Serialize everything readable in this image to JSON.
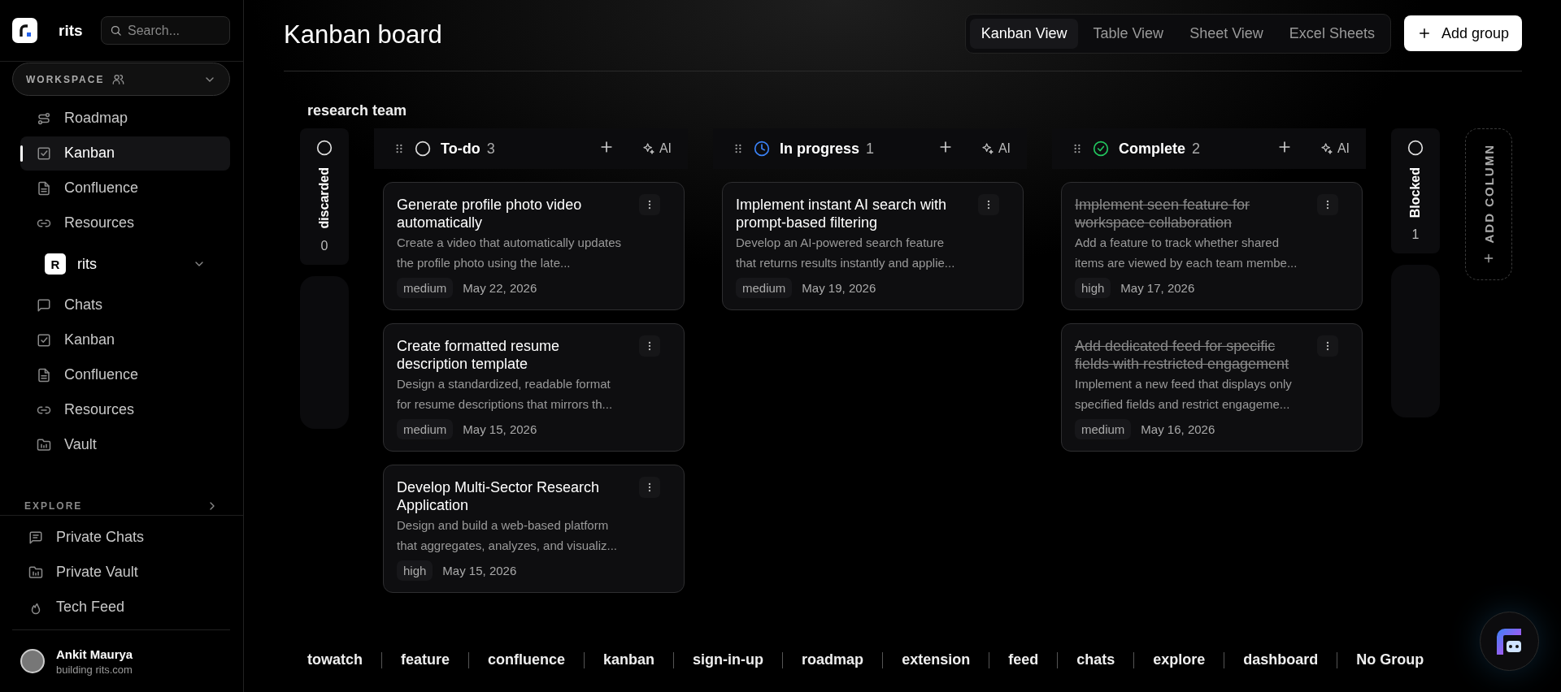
{
  "sidebar": {
    "brand": "rits",
    "search": {
      "placeholder": "Search..."
    },
    "workspace": {
      "label": "WORKSPACE"
    },
    "nav": [
      {
        "label": "Roadmap",
        "kind": "roadmap",
        "selected": false
      },
      {
        "label": "Kanban",
        "kind": "kanban",
        "selected": true
      },
      {
        "label": "Confluence",
        "kind": "doc",
        "selected": false
      },
      {
        "label": "Resources",
        "kind": "link",
        "selected": false
      }
    ],
    "team": {
      "badge": "R",
      "name": "rits",
      "expanded": true,
      "items": [
        {
          "label": "Chats",
          "kind": "chat",
          "selected": false
        },
        {
          "label": "Kanban",
          "kind": "kanban",
          "selected": false
        },
        {
          "label": "Confluence",
          "kind": "doc",
          "selected": false
        },
        {
          "label": "Resources",
          "kind": "link",
          "selected": false
        },
        {
          "label": "Vault",
          "kind": "vault",
          "selected": false
        }
      ]
    },
    "explore": "EXPLORE",
    "private": [
      {
        "label": "Private Chats",
        "kind": "chat2",
        "selected": false
      },
      {
        "label": "Private Vault",
        "kind": "vault",
        "selected": false
      },
      {
        "label": "Tech Feed",
        "kind": "fire",
        "selected": false
      }
    ],
    "user": {
      "name": "Ankit Maurya",
      "subtitle": "building rits.com"
    }
  },
  "header": {
    "title": "Kanban board",
    "views": [
      {
        "label": "Kanban View",
        "selected": true
      },
      {
        "label": "Table View",
        "selected": false
      },
      {
        "label": "Sheet View",
        "selected": false
      },
      {
        "label": "Excel Sheets",
        "selected": false
      }
    ],
    "add_group": "Add group"
  },
  "board": {
    "group": "research team",
    "columns": [
      {
        "kind": "collapsed",
        "title": "discarded",
        "count": "0"
      },
      {
        "kind": "todo",
        "title": "To-do",
        "count": "3",
        "ai": "AI",
        "cards": [
          {
            "title": "Generate profile photo video automatically",
            "description": "Create a video that automatically updates the profile photo using the late...",
            "priority": "medium",
            "date": "May 22, 2026",
            "done": false
          },
          {
            "title": "Create formatted resume description template",
            "description": "Design a standardized, readable format for resume descriptions that mirrors th...",
            "priority": "medium",
            "date": "May 15, 2026",
            "done": false
          },
          {
            "title": "Develop Multi-Sector Research Application",
            "description": "Design and build a web-based platform that aggregates, analyzes, and visualiz...",
            "priority": "high",
            "date": "May 15, 2026",
            "done": false
          }
        ]
      },
      {
        "kind": "progress",
        "title": "In progress",
        "count": "1",
        "ai": "AI",
        "cards": [
          {
            "title": "Implement instant AI search with prompt-based filtering",
            "description": "Develop an AI-powered search feature that returns results instantly and applie...",
            "priority": "medium",
            "date": "May 19, 2026",
            "done": false
          }
        ]
      },
      {
        "kind": "complete",
        "title": "Complete",
        "count": "2",
        "ai": "AI",
        "cards": [
          {
            "title": "Implement seen feature for workspace collaboration",
            "description": "Add a feature to track whether shared items are viewed by each team membe...",
            "priority": "high",
            "date": "May 17, 2026",
            "done": true
          },
          {
            "title": "Add dedicated feed for specific fields with restricted engagement",
            "description": "Implement a new feed that displays only specified fields and restrict engageme...",
            "priority": "medium",
            "date": "May 16, 2026",
            "done": true
          }
        ]
      },
      {
        "kind": "collapsed",
        "title": "Blocked",
        "count": "1"
      }
    ],
    "add_column": "ADD COLUMN"
  },
  "groups": [
    "towatch",
    "feature",
    "confluence",
    "kanban",
    "sign-in-up",
    "roadmap",
    "extension",
    "feed",
    "chats",
    "explore",
    "dashboard",
    "No Group"
  ]
}
